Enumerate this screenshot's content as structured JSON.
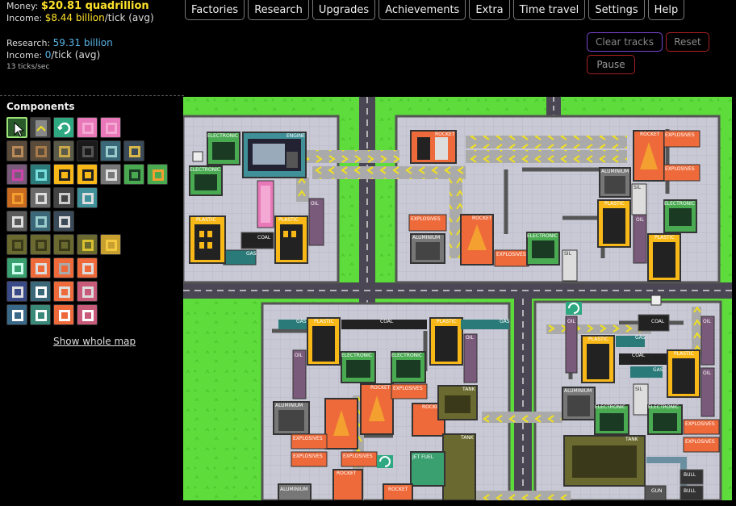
{
  "stats": {
    "money_label": "Money:",
    "money_value": "$20.81 quadrillion",
    "income_label": "Income:",
    "income_value": "$8.44 billion",
    "income_suffix": "/tick (avg)",
    "research_label": "Research:",
    "research_value": "59.31 billion",
    "research_income_label": "Income:",
    "research_income_value": "0",
    "research_income_suffix": "/tick (avg)",
    "speed": "13 ticks/sec"
  },
  "nav": [
    "Factories",
    "Research",
    "Upgrades",
    "Achievements",
    "Extra",
    "Time travel",
    "Settings",
    "Help"
  ],
  "controls": {
    "clear_tracks": "Clear tracks",
    "reset": "Reset",
    "pause": "Pause"
  },
  "components": {
    "title": "Components",
    "show_map": "Show whole map",
    "rows": [
      [
        "cursor",
        "conveyor",
        "rotate",
        "pink-buyer",
        "pink-seller"
      ],
      [
        "iron-ore",
        "iron-foundry",
        "sorter",
        "coal-mine",
        "steel-mill",
        "gear-press"
      ],
      [
        "oil-well",
        "gas-plant",
        "plastic-factory",
        "plastic-press",
        "silicon-mine",
        "electronics-factory",
        "explosives-plant"
      ],
      [
        "aluminium-smelter",
        "wire-press",
        "engine-part",
        "engine-assembly"
      ],
      [
        "circuit-grid",
        "processor",
        "robot-arm"
      ],
      [
        "tank-part-a",
        "tank-part-b",
        "tank-part-c",
        "tank-assembly",
        "barrel-stack"
      ],
      [
        "jet-fuel",
        "canister",
        "rocket-part",
        "rocket-assembly"
      ],
      [
        "battery",
        "gauge",
        "server",
        "console"
      ],
      [
        "computer-a",
        "computer-b",
        "computer-c",
        "computer-d"
      ]
    ]
  },
  "map": {
    "labels": {
      "electronic": "ELECTRONIC",
      "engine": "ENGINE",
      "plastic": "PLASTIC",
      "coal": "COAL",
      "gas": "GAS",
      "oil": "OIL",
      "rocket": "ROCKET",
      "explosives": "EXPLOSIVES",
      "aluminium": "ALUMINIUM",
      "sil": "SIL",
      "tank": "TANK",
      "jet_fuel": "JET FUEL",
      "bull": "BULL",
      "gun": "GUN"
    }
  },
  "colors": {
    "grass": "#5ddc3b",
    "road": "#4a4654",
    "floor": "#c8c8d4",
    "belt": "#b8b8b8",
    "arrow": "#f0e020",
    "accent": "#ffe22a",
    "research": "#58b4e6"
  }
}
